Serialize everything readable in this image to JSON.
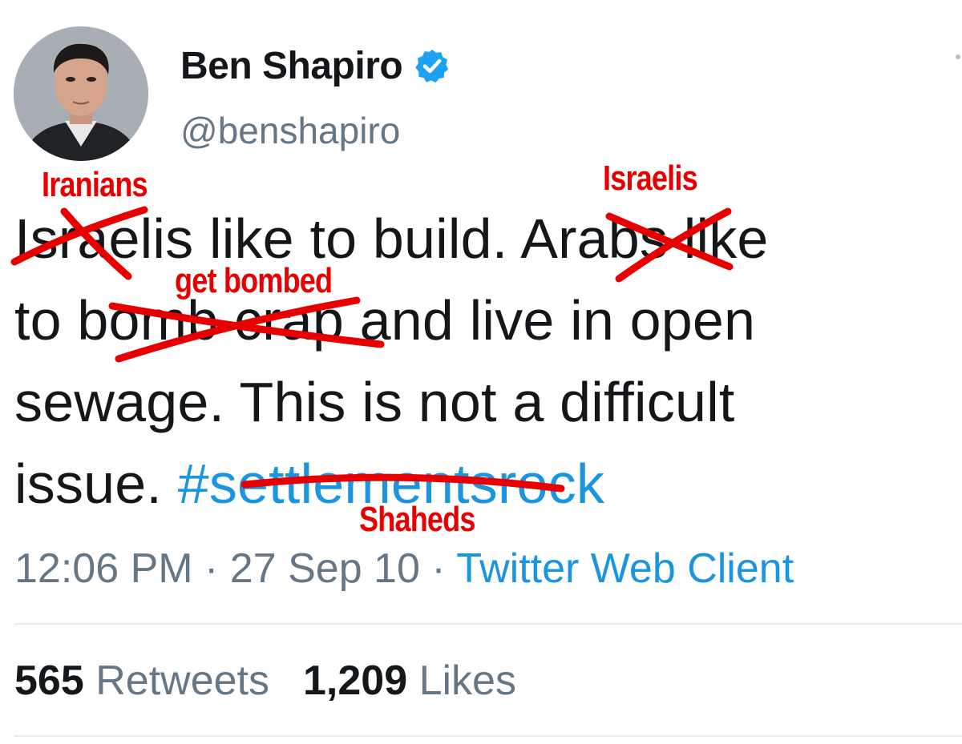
{
  "author": {
    "display_name": "Ben Shapiro",
    "handle": "@benshapiro",
    "verified_color": "#1da1f2"
  },
  "tweet": {
    "line1": "Israelis like to build. Arabs like",
    "line2": "to bomb crap and live in open",
    "line3": "sewage. This is not a difficult",
    "line4_prefix": "issue. ",
    "hashtag": "#settlementsrock"
  },
  "edits": {
    "iranians": "Iranians",
    "israelis": "Israelis",
    "get_bombed": "get bombed",
    "shaheds": "Shaheds",
    "color": "#e80000"
  },
  "meta": {
    "time": "12:06 PM",
    "sep1": " · ",
    "date": "27 Sep 10",
    "sep2": " · ",
    "source": "Twitter Web Client"
  },
  "stats": {
    "retweets_count": "565",
    "retweets_label": "Retweets",
    "likes_count": "1,209",
    "likes_label": "Likes"
  }
}
